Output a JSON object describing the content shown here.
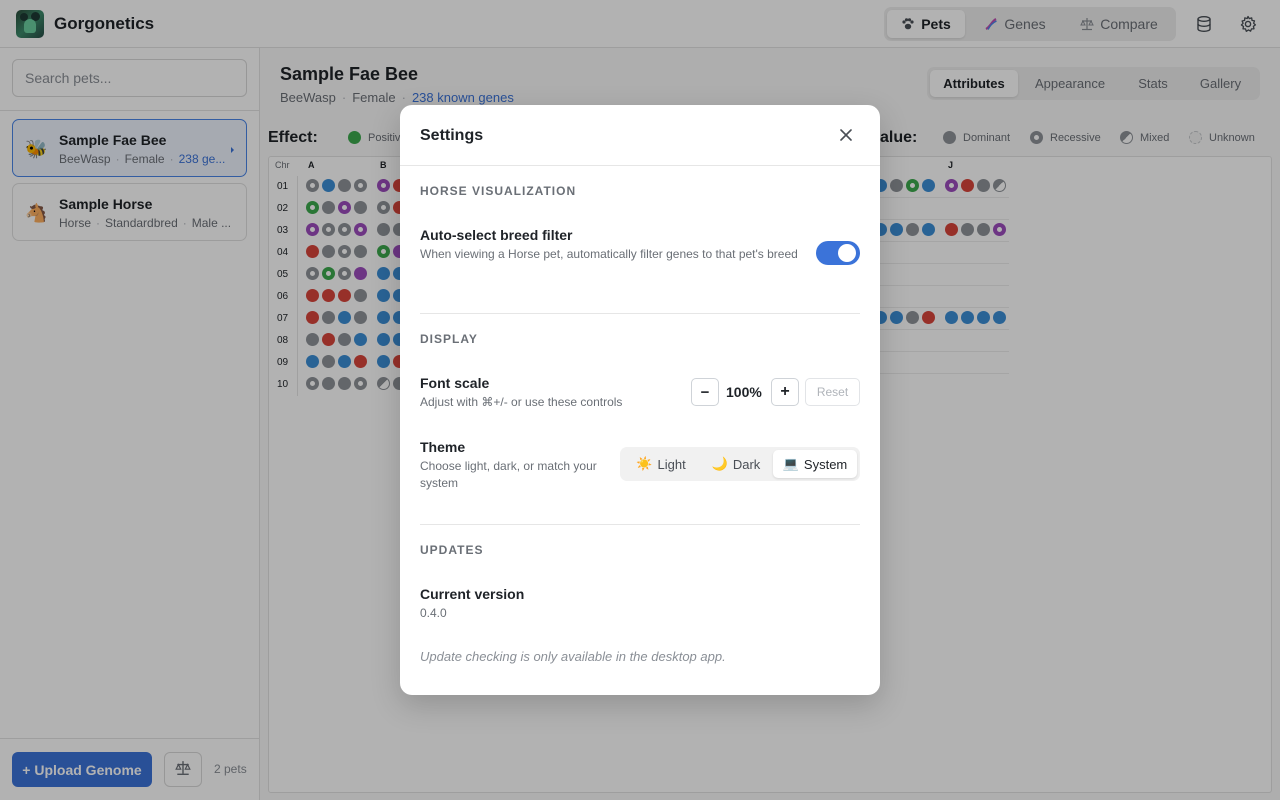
{
  "app": {
    "title": "Gorgonetics"
  },
  "nav": {
    "items": [
      {
        "label": "Pets",
        "icon": "paw-icon",
        "active": true
      },
      {
        "label": "Genes",
        "icon": "dna-icon",
        "active": false
      },
      {
        "label": "Compare",
        "icon": "scale-icon",
        "active": false
      }
    ]
  },
  "sidebar": {
    "search_placeholder": "Search pets...",
    "pets": [
      {
        "name": "Sample Fae Bee",
        "emoji": "🐝",
        "species": "BeeWasp",
        "gender": "Female",
        "genes": "238 ge...",
        "selected": true
      },
      {
        "name": "Sample Horse",
        "emoji": "🐴",
        "species": "Horse",
        "breed": "Standardbred",
        "gender": "Male ...",
        "selected": false
      }
    ],
    "upload_label": "+ Upload Genome",
    "pet_count": "2 pets"
  },
  "main": {
    "title": "Sample Fae Bee",
    "species": "BeeWasp",
    "gender": "Female",
    "genes_link": "238 known genes",
    "tabs": [
      {
        "label": "Attributes",
        "active": true
      },
      {
        "label": "Appearance",
        "active": false
      },
      {
        "label": "Stats",
        "active": false
      },
      {
        "label": "Gallery",
        "active": false
      }
    ],
    "effect_label": "Effect:",
    "effect_legend": {
      "positive": "Positiv"
    },
    "value_label": "alue:",
    "value_legend": [
      "Dominant",
      "Recessive",
      "Mixed",
      "Unknown"
    ],
    "grid": {
      "chr_header": "Chr",
      "columns_left": [
        "A",
        "B"
      ],
      "columns_right": [
        "J"
      ],
      "rows": [
        "01",
        "02",
        "03",
        "04",
        "05",
        "06",
        "07",
        "08",
        "09",
        "10"
      ],
      "colors": {
        "grey": "#8e9298",
        "blue": "#3b8fd6",
        "purple": "#9c4dbe",
        "green": "#3daa4e",
        "red": "#d9453b"
      },
      "genes_a": [
        [
          "go",
          "b",
          "g",
          "go"
        ],
        [
          "Go",
          "g",
          "Po",
          "g"
        ],
        [
          "Po",
          "go",
          "go",
          "Po"
        ],
        [
          "r",
          "g",
          "go",
          "g"
        ],
        [
          "go",
          "Go",
          "go",
          "p"
        ],
        [
          "r",
          "r",
          "r",
          "g"
        ],
        [
          "r",
          "g",
          "b",
          "g"
        ],
        [
          "g",
          "r",
          "g",
          "b"
        ],
        [
          "b",
          "g",
          "b",
          "r"
        ],
        [
          "go",
          "g",
          "g",
          "go"
        ]
      ],
      "genes_b": [
        [
          "Po",
          "r"
        ],
        [
          "go",
          "r"
        ],
        [
          "g",
          "g"
        ],
        [
          "Go",
          "p"
        ],
        [
          "b",
          "b"
        ],
        [
          "b",
          "b"
        ],
        [
          "b",
          "b"
        ],
        [
          "b",
          "b"
        ],
        [
          "b",
          "r"
        ],
        [
          "m",
          "g"
        ]
      ],
      "genes_i": [
        [
          "b",
          "g",
          "Go",
          "b"
        ],
        null,
        [
          "b",
          "b",
          "g",
          "b"
        ],
        null,
        null,
        null,
        [
          "b",
          "b",
          "g",
          "r"
        ],
        null,
        null,
        null
      ],
      "genes_j": [
        [
          "Po",
          "r",
          "g",
          "m"
        ],
        null,
        [
          "r",
          "g",
          "g",
          "Po"
        ],
        null,
        null,
        null,
        [
          "b",
          "b",
          "b",
          "b"
        ],
        null,
        null,
        null
      ]
    }
  },
  "settings": {
    "title": "Settings",
    "horse_section": "HORSE VISUALIZATION",
    "auto_breed_label": "Auto-select breed filter",
    "auto_breed_desc": "When viewing a Horse pet, automatically filter genes to that pet's breed",
    "auto_breed_on": true,
    "display_section": "DISPLAY",
    "font_scale_label": "Font scale",
    "font_scale_desc": "Adjust with ⌘+/- or use these controls",
    "font_scale_value": "100%",
    "minus_label": "−",
    "plus_label": "+",
    "reset_label": "Reset",
    "theme_label": "Theme",
    "theme_desc": "Choose light, dark, or match your system",
    "themes": [
      {
        "label": "Light",
        "emoji": "☀️",
        "active": false
      },
      {
        "label": "Dark",
        "emoji": "🌙",
        "active": false
      },
      {
        "label": "System",
        "emoji": "💻",
        "active": true
      }
    ],
    "updates_section": "UPDATES",
    "version_label": "Current version",
    "version_value": "0.4.0",
    "update_note": "Update checking is only available in the desktop app."
  }
}
